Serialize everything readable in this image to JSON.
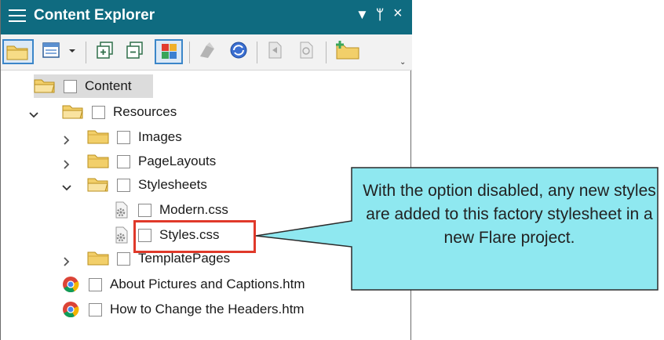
{
  "panel": {
    "title": "Content Explorer",
    "controls": {
      "menu_glyph": "▼",
      "pin_glyph": "ᛘ",
      "close_glyph": "×"
    },
    "toolbar": {
      "overflow_glyph": "⌄",
      "icons": [
        "open-folder-icon",
        "view-mode-icon",
        "dropdown-caret-icon",
        "expand-all-icon",
        "collapse-all-icon",
        "show-files-icon",
        "link-icon",
        "sync-icon",
        "document-icon",
        "preview-icon",
        "new-folder-icon"
      ]
    }
  },
  "tree": {
    "root": {
      "label": "Content"
    },
    "resources": {
      "label": "Resources"
    },
    "images": {
      "label": "Images"
    },
    "page_layouts": {
      "label": "PageLayouts"
    },
    "stylesheets": {
      "label": "Stylesheets"
    },
    "modern_css": {
      "label": "Modern.css"
    },
    "styles_css": {
      "label": "Styles.css"
    },
    "template_pages": {
      "label": "TemplatePages"
    },
    "about_pictures": {
      "label": "About Pictures and Captions.htm"
    },
    "how_to_change": {
      "label": "How to Change the Headers.htm"
    }
  },
  "callout": {
    "text": "With the option disabled, any new styles are added to this factory stylesheet in a new Flare project."
  },
  "colors": {
    "titlebar": "#0f6b80",
    "callout_fill": "#8fe8f0",
    "highlight": "#e0392a",
    "selected_button": "#3b86c9",
    "folder": "#f2cf6a"
  }
}
